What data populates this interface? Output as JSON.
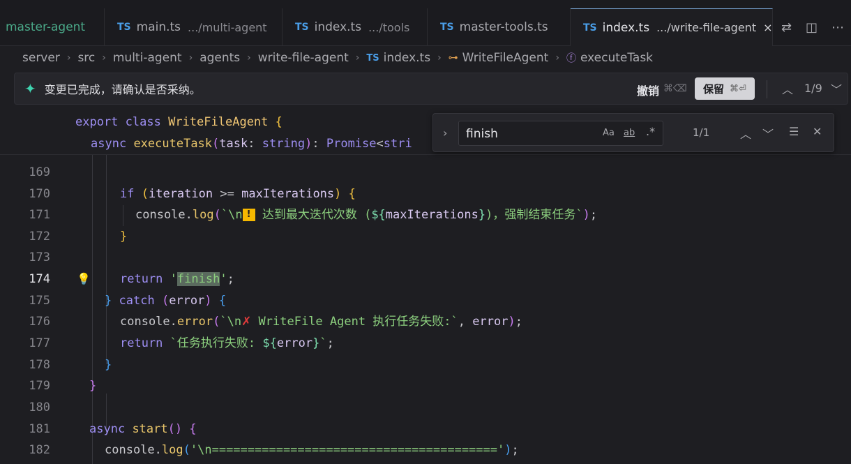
{
  "tabs": [
    {
      "label": "master-agent",
      "dir": "",
      "lang": "",
      "active": false
    },
    {
      "label": "main.ts",
      "dir": ".../multi-agent",
      "lang": "TS",
      "active": false
    },
    {
      "label": "index.ts",
      "dir": ".../tools",
      "lang": "TS",
      "active": false
    },
    {
      "label": "master-tools.ts",
      "dir": "",
      "lang": "TS",
      "active": false
    },
    {
      "label": "index.ts",
      "dir": ".../write-file-agent",
      "lang": "TS",
      "active": true,
      "close": "×"
    }
  ],
  "breadcrumb": {
    "items": [
      "server",
      "src",
      "multi-agent",
      "agents",
      "write-file-agent"
    ],
    "file_lang": "TS",
    "file": "index.ts",
    "class": "WriteFileAgent",
    "method": "executeTask"
  },
  "changebar": {
    "message": "变更已完成，请确认是否采纳。",
    "undo_label": "撤销",
    "undo_shortcut": "⌘⌫",
    "keep_label": "保留",
    "keep_shortcut": "⌘⏎",
    "counter": "1/9"
  },
  "find": {
    "value": "finish",
    "match_case": "Aa",
    "whole_word": "ab",
    "regex": ".*",
    "result": "1/1"
  },
  "sticky": {
    "line1": "export class WriteFileAgent {",
    "line2": "async executeTask(task: string): Promise<stri"
  },
  "lines": [
    {
      "n": "169"
    },
    {
      "n": "170"
    },
    {
      "n": "171"
    },
    {
      "n": "172"
    },
    {
      "n": "173"
    },
    {
      "n": "174"
    },
    {
      "n": "175"
    },
    {
      "n": "176"
    },
    {
      "n": "177"
    },
    {
      "n": "178"
    },
    {
      "n": "179"
    },
    {
      "n": "180"
    },
    {
      "n": "181"
    },
    {
      "n": "182"
    }
  ],
  "code": {
    "l171_text": " 达到最大迭代次数 (",
    "l171_tail": ")，强制结束任务",
    "l174_str": "finish",
    "l176_text": " WriteFile Agent 执行任务失败:",
    "l177_text": "任务执行失败: ",
    "l182_str": "\\n========================================"
  },
  "colors": {
    "accent": "#7aa8d8",
    "ts_badge": "#4a9ee8",
    "sparkle": "#3fd4b0"
  }
}
